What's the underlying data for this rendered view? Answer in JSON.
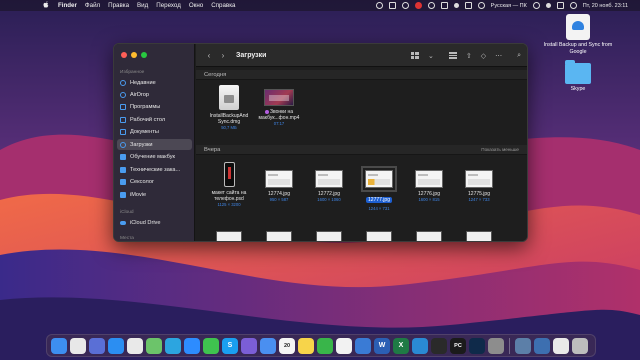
{
  "menubar": {
    "apple": "",
    "app_name": "Finder",
    "items": [
      "Файл",
      "Правка",
      "Вид",
      "Переход",
      "Окно",
      "Справка"
    ],
    "input_source": "Русская — ПК",
    "datetime": "Пт, 20 нояб. 23:11"
  },
  "desktop": {
    "icons": [
      {
        "label": "Install Backup and Sync from Google",
        "icon": "google-backup-icon"
      },
      {
        "label": "Skype",
        "icon": "folder-icon"
      }
    ]
  },
  "finder": {
    "title": "Загрузки",
    "sidebar": {
      "favorites_label": "Избранное",
      "items": [
        {
          "label": "Недавние",
          "icon": "clock-icon"
        },
        {
          "label": "AirDrop",
          "icon": "airdrop-icon"
        },
        {
          "label": "Программы",
          "icon": "applications-icon"
        },
        {
          "label": "Рабочий стол",
          "icon": "desktop-icon"
        },
        {
          "label": "Документы",
          "icon": "document-icon"
        },
        {
          "label": "Загрузки",
          "icon": "downloads-icon",
          "active": true
        },
        {
          "label": "Обучение макбук",
          "icon": "folder-icon"
        },
        {
          "label": "Технические зака...",
          "icon": "folder-icon"
        },
        {
          "label": "Сексолог",
          "icon": "folder-icon"
        },
        {
          "label": "iMovie",
          "icon": "folder-icon"
        }
      ],
      "icloud_label": "iCloud",
      "icloud_items": [
        {
          "label": "iCloud Drive",
          "icon": "cloud-icon"
        }
      ],
      "places_label": "Места"
    },
    "sections": {
      "today": "Сегодня",
      "yesterday": "Вчера",
      "show_less": "Показать меньше"
    },
    "today_files": [
      {
        "name1": "InstallBackupAnd",
        "name2": "Sync.dmg",
        "meta": "50,7 МБ",
        "kind": "dmg"
      },
      {
        "name1": "Звонки на",
        "name2": "макбук...фон.mp4",
        "meta": "07:17",
        "kind": "video",
        "tagged": true
      }
    ],
    "yesterday_files": [
      {
        "name1": "макет сайта на",
        "name2": "телефон.psd",
        "meta": "1125 × 3200",
        "kind": "psd"
      },
      {
        "name1": "12774.jpg",
        "name2": "",
        "meta": "950 × 587",
        "kind": "shot"
      },
      {
        "name1": "12772.jpg",
        "name2": "",
        "meta": "1600 × 1060",
        "kind": "shot"
      },
      {
        "name1": "12777.jpg",
        "name2": "",
        "meta": "1244 × 731",
        "kind": "shot",
        "selected": true
      },
      {
        "name1": "12776.jpg",
        "name2": "",
        "meta": "1600 × 815",
        "kind": "shot"
      },
      {
        "name1": "12775.jpg",
        "name2": "",
        "meta": "1247 × 733",
        "kind": "shot"
      }
    ]
  },
  "dock": {
    "apps": [
      {
        "icon": "finder-icon",
        "color": "#3d8ef0",
        "glyph": ""
      },
      {
        "icon": "launchpad-icon",
        "color": "#e8e8e8",
        "glyph": ""
      },
      {
        "icon": "mission-control-icon",
        "color": "#5a6fd6",
        "glyph": ""
      },
      {
        "icon": "safari-icon",
        "color": "#2b8ef2",
        "glyph": ""
      },
      {
        "icon": "chrome-icon",
        "color": "#e9e9e9",
        "glyph": ""
      },
      {
        "icon": "maps-icon",
        "color": "#6cc46a",
        "glyph": ""
      },
      {
        "icon": "telegram-icon",
        "color": "#2ca5e0",
        "glyph": ""
      },
      {
        "icon": "zoom-icon",
        "color": "#2d8cff",
        "glyph": ""
      },
      {
        "icon": "facetime-icon",
        "color": "#3fc34f",
        "glyph": ""
      },
      {
        "icon": "skype-icon",
        "color": "#1a9ff0",
        "glyph": "S"
      },
      {
        "icon": "viber-icon",
        "color": "#7b5ed6",
        "glyph": ""
      },
      {
        "icon": "mail-icon",
        "color": "#4a8ff0",
        "glyph": ""
      },
      {
        "icon": "calendar-icon",
        "color": "#f4f4f4",
        "glyph": "20"
      },
      {
        "icon": "notes-icon",
        "color": "#f7d44a",
        "glyph": ""
      },
      {
        "icon": "facetime2-icon",
        "color": "#39b54a",
        "glyph": ""
      },
      {
        "icon": "photos-icon",
        "color": "#f2f2f2",
        "glyph": ""
      },
      {
        "icon": "keynote-icon",
        "color": "#3a7bd5",
        "glyph": ""
      },
      {
        "icon": "word-icon",
        "color": "#2b5fb4",
        "glyph": "W"
      },
      {
        "icon": "excel-icon",
        "color": "#1f7a45",
        "glyph": "X"
      },
      {
        "icon": "vscode-icon",
        "color": "#2a8ad4",
        "glyph": ""
      },
      {
        "icon": "ide-icon",
        "color": "#2a2a2a",
        "glyph": ""
      },
      {
        "icon": "pycharm-icon",
        "color": "#1b1b1b",
        "glyph": "PC"
      },
      {
        "icon": "photoshop-icon",
        "color": "#0f2a4a",
        "glyph": ""
      },
      {
        "icon": "system-prefs-icon",
        "color": "#8d8d8d",
        "glyph": ""
      }
    ],
    "right_apps": [
      {
        "icon": "preview-icon",
        "color": "#5c7fa8",
        "glyph": ""
      },
      {
        "icon": "screen-icon",
        "color": "#3d6fb0",
        "glyph": ""
      },
      {
        "icon": "downloads-stack-icon",
        "color": "#e9e9e9",
        "glyph": ""
      },
      {
        "icon": "trash-icon",
        "color": "#bdbdbd",
        "glyph": ""
      }
    ]
  },
  "colors": {
    "wallpaper_top": "#2a1f55",
    "wallpaper_mid": "#c2336a",
    "wallpaper_bottom": "#f06a48",
    "accent": "#1d5fd1"
  }
}
